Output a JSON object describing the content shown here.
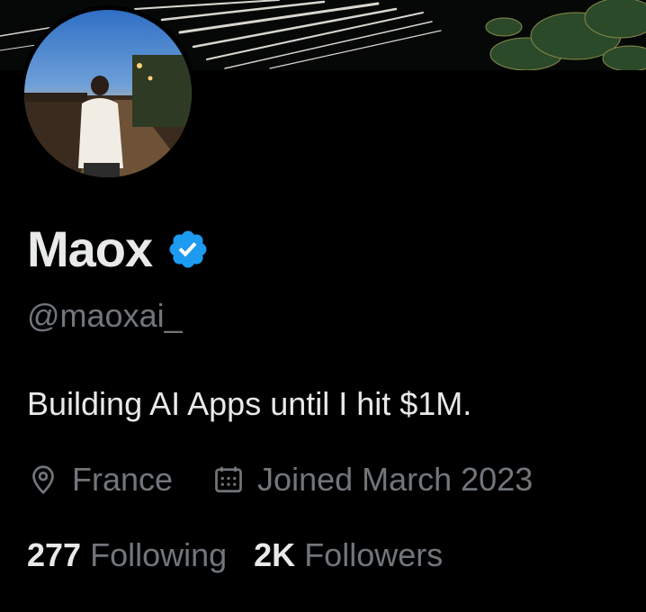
{
  "profile": {
    "name": "Maox",
    "verified": true,
    "handle": "@maoxai_",
    "bio": "Building AI Apps until I hit $1M.",
    "location": "France",
    "joined": "Joined March 2023",
    "following_count": "277",
    "following_label": "Following",
    "followers_count": "2K",
    "followers_label": "Followers"
  },
  "icons": {
    "verified": "verified-badge-icon",
    "location": "location-pin-icon",
    "joined": "calendar-icon"
  },
  "colors": {
    "background": "#000000",
    "primary_text": "#e7e9ea",
    "secondary_text": "#71767b",
    "verified_blue": "#1d9bf0"
  }
}
